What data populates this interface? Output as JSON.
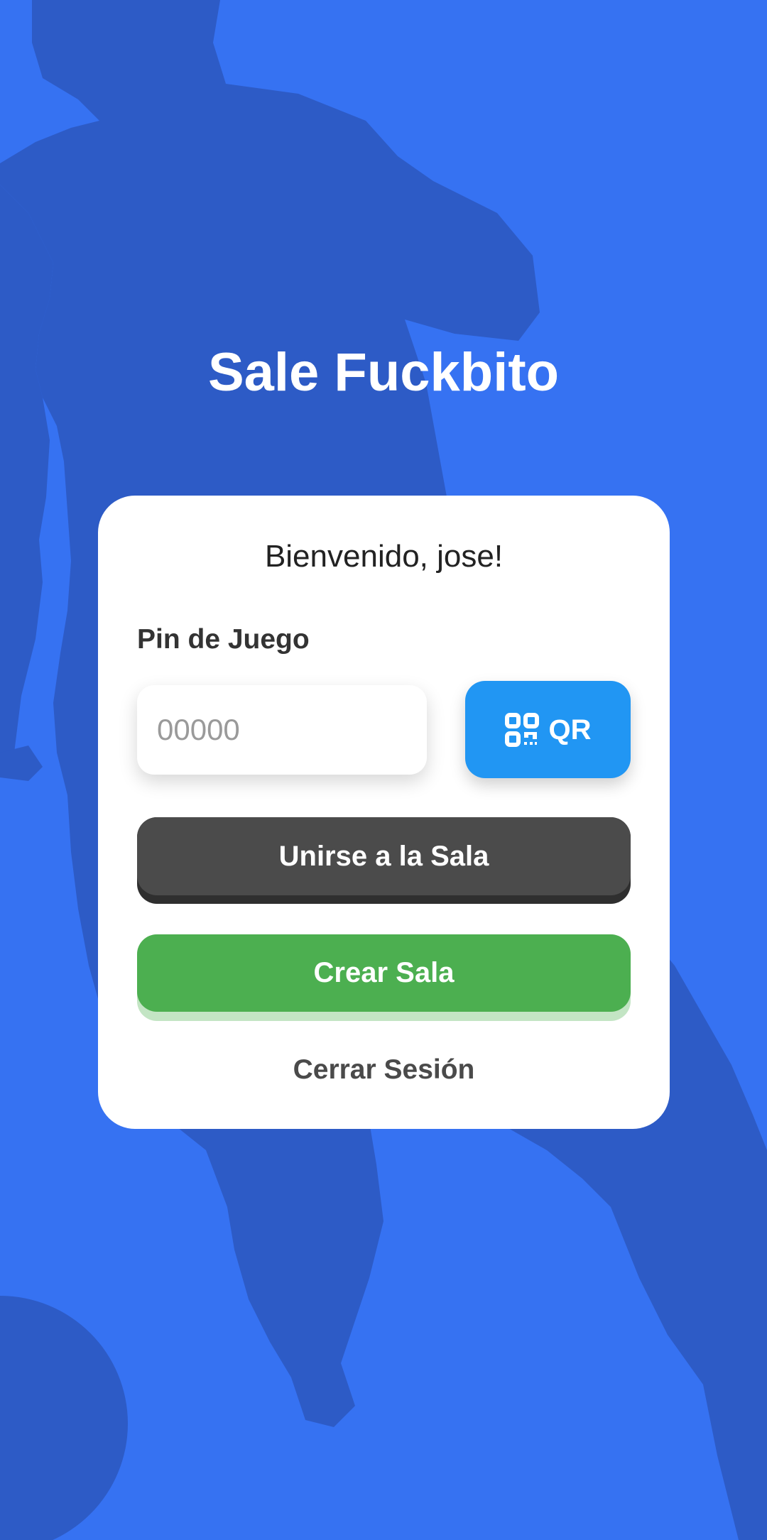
{
  "app": {
    "title": "Sale Fuckbito",
    "background_color": "#3672F2",
    "silhouette_color": "#2D5BC6"
  },
  "card": {
    "welcome": "Bienvenido, jose!",
    "pin_label": "Pin de Juego",
    "pin_input": {
      "value": "",
      "placeholder": "00000"
    },
    "qr_button": {
      "label": "QR",
      "icon": "qr-code-icon",
      "color": "#2196F3"
    },
    "join_button": {
      "label": "Unirse a la Sala",
      "color": "#4B4B4B"
    },
    "create_button": {
      "label": "Crear Sala",
      "color": "#4CAF50"
    },
    "logout_link": {
      "label": "Cerrar Sesión"
    }
  }
}
